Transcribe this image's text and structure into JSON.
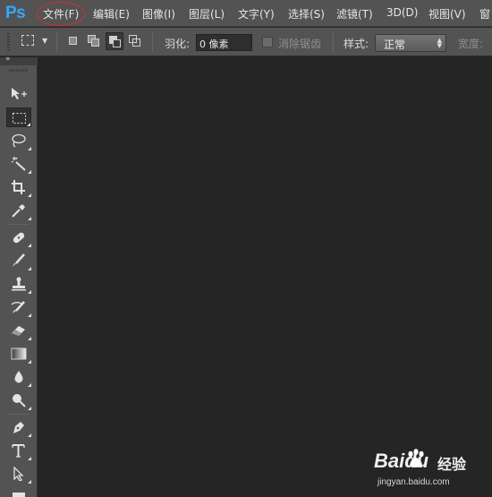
{
  "app": {
    "logo": "Ps"
  },
  "menubar": {
    "items": [
      "文件(F)",
      "编辑(E)",
      "图像(I)",
      "图层(L)",
      "文字(Y)",
      "选择(S)",
      "滤镜(T)",
      "3D(D)",
      "视图(V)",
      "窗"
    ]
  },
  "options_bar": {
    "feather_label": "羽化:",
    "feather_value": "0 像素",
    "antialias_label": "消除锯齿",
    "style_label": "样式:",
    "style_value": "正常",
    "width_label": "宽度:"
  },
  "tools": [
    "move-tool",
    "rectangular-marquee-tool",
    "lasso-tool",
    "magic-wand-tool",
    "crop-tool",
    "eyedropper-tool",
    "spot-healing-brush-tool",
    "brush-tool",
    "clone-stamp-tool",
    "history-brush-tool",
    "eraser-tool",
    "gradient-tool",
    "blur-tool",
    "dodge-tool",
    "pen-tool",
    "type-tool",
    "path-selection-tool",
    "rectangle-tool"
  ],
  "watermark": {
    "brand": "Baidu",
    "product": "经验",
    "url": "jingyan.baidu.com"
  },
  "colors": {
    "logo": "#31a8ff",
    "chrome": "#535353",
    "canvas": "#252525",
    "highlight_circle": "#cf3030"
  }
}
